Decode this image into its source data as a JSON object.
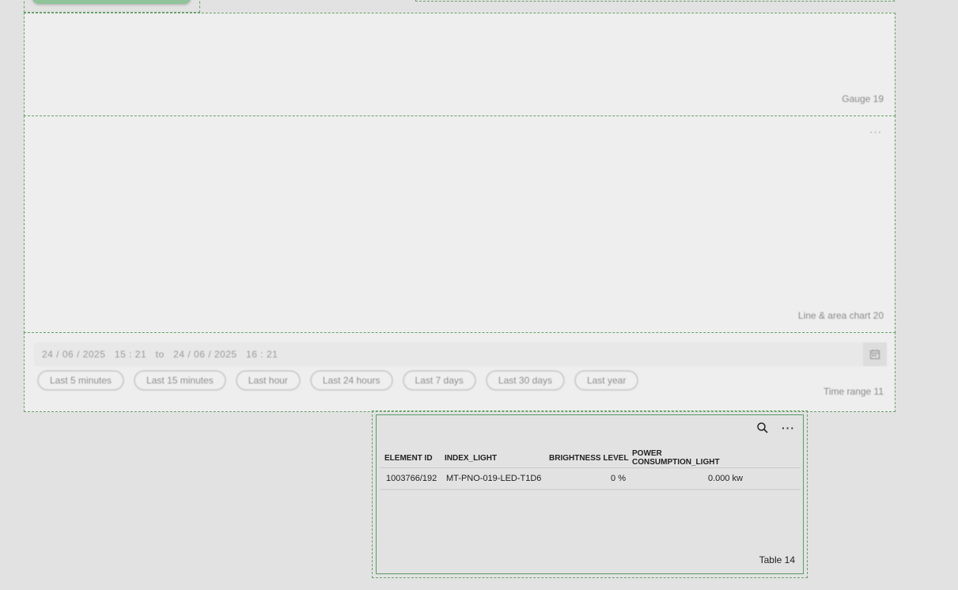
{
  "gauge": {
    "caption": "Gauge 19"
  },
  "line_chart": {
    "caption": "Line & area chart 20",
    "more_label": "···"
  },
  "time_range": {
    "from_date": "24 / 06 / 2025",
    "from_time": "15 : 21",
    "separator": "to",
    "to_date": "24 / 06 / 2025",
    "to_time": "16 : 21",
    "presets": [
      "Last 5 minutes",
      "Last 15 minutes",
      "Last hour",
      "Last 24 hours",
      "Last 7 days",
      "Last 30 days",
      "Last year"
    ],
    "caption": "Time range 11"
  },
  "table": {
    "more_label": "···",
    "columns": [
      "ELEMENT ID",
      "INDEX_LIGHT",
      "BRIGHTNESS LEVEL",
      "POWER CONSUMPTION_LIGHT"
    ],
    "rows": [
      [
        "1003766/192",
        "MT-PNO-019-LED-T1D6",
        "0 %",
        "0.000 kw"
      ]
    ],
    "caption": "Table 14"
  },
  "icons": {
    "calendar": "calendar-icon",
    "search": "search-icon",
    "more": "more-icon"
  }
}
